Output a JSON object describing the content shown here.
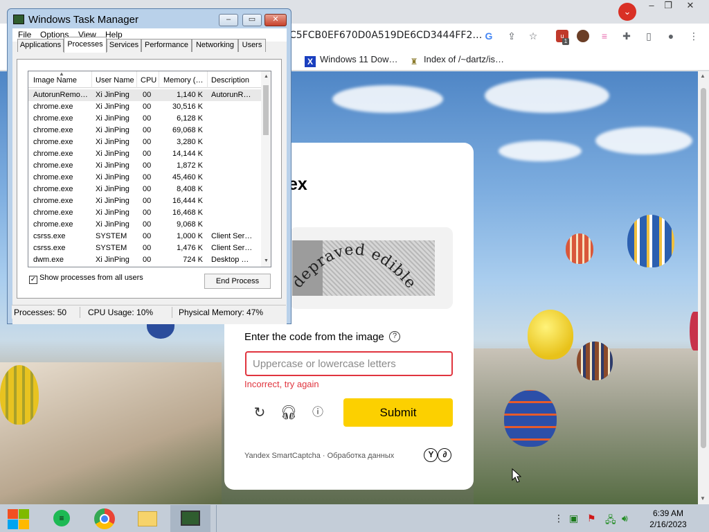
{
  "browser": {
    "url": "C5FCB0EF670D0A519DE6CD3444FF2…",
    "tab_search_icon": "chevron-down-icon",
    "window_controls": [
      "–",
      "❐",
      "✕"
    ],
    "bookmarks": [
      {
        "label": "Windows 11 Dow…",
        "icon": "x-icon"
      },
      {
        "label": "Index of /~dartz/is…",
        "icon": "folder-icon"
      }
    ],
    "extension_badge": "1"
  },
  "task_manager": {
    "title": "Windows Task Manager",
    "menu": [
      "File",
      "Options",
      "View",
      "Help"
    ],
    "tabs": [
      "Applications",
      "Processes",
      "Services",
      "Performance",
      "Networking",
      "Users"
    ],
    "active_tab": "Processes",
    "columns": [
      "Image Name",
      "User Name",
      "CPU",
      "Memory (…",
      "Description"
    ],
    "rows": [
      {
        "name": "AutorunRemo…",
        "user": "Xi JinPing",
        "cpu": "00",
        "mem": "1,140 K",
        "desc": "AutorunR…"
      },
      {
        "name": "chrome.exe",
        "user": "Xi JinPing",
        "cpu": "00",
        "mem": "30,516 K",
        "desc": ""
      },
      {
        "name": "chrome.exe",
        "user": "Xi JinPing",
        "cpu": "00",
        "mem": "6,128 K",
        "desc": ""
      },
      {
        "name": "chrome.exe",
        "user": "Xi JinPing",
        "cpu": "00",
        "mem": "69,068 K",
        "desc": ""
      },
      {
        "name": "chrome.exe",
        "user": "Xi JinPing",
        "cpu": "00",
        "mem": "3,280 K",
        "desc": ""
      },
      {
        "name": "chrome.exe",
        "user": "Xi JinPing",
        "cpu": "00",
        "mem": "14,144 K",
        "desc": ""
      },
      {
        "name": "chrome.exe",
        "user": "Xi JinPing",
        "cpu": "00",
        "mem": "1,872 K",
        "desc": ""
      },
      {
        "name": "chrome.exe",
        "user": "Xi JinPing",
        "cpu": "00",
        "mem": "45,460 K",
        "desc": ""
      },
      {
        "name": "chrome.exe",
        "user": "Xi JinPing",
        "cpu": "00",
        "mem": "8,408 K",
        "desc": ""
      },
      {
        "name": "chrome.exe",
        "user": "Xi JinPing",
        "cpu": "00",
        "mem": "16,444 K",
        "desc": ""
      },
      {
        "name": "chrome.exe",
        "user": "Xi JinPing",
        "cpu": "00",
        "mem": "16,468 K",
        "desc": ""
      },
      {
        "name": "chrome.exe",
        "user": "Xi JinPing",
        "cpu": "00",
        "mem": "9,068 K",
        "desc": ""
      },
      {
        "name": "csrss.exe",
        "user": "SYSTEM",
        "cpu": "00",
        "mem": "1,000 K",
        "desc": "Client Ser…"
      },
      {
        "name": "csrss.exe",
        "user": "SYSTEM",
        "cpu": "00",
        "mem": "1,476 K",
        "desc": "Client Ser…"
      },
      {
        "name": "dwm.exe",
        "user": "Xi JinPing",
        "cpu": "00",
        "mem": "724 K",
        "desc": "Desktop …"
      }
    ],
    "show_all_label": "Show processes from all users",
    "show_all_checked": true,
    "end_process_label": "End Process",
    "status": {
      "processes": "Processes: 50",
      "cpu": "CPU Usage: 10%",
      "memory": "Physical Memory: 47%"
    }
  },
  "captcha": {
    "brand": "ex",
    "image_text": "depraved edible",
    "prompt": "Enter the code from the image",
    "input_placeholder": "Uppercase or lowercase letters",
    "input_value": "",
    "error": "Incorrect, try again",
    "submit_label": "Submit",
    "footer": "Yandex SmartCaptcha · Обработка данных",
    "footer_logo_letters": [
      "Y",
      "∂"
    ],
    "accent_color": "#fcd000",
    "error_color": "#e0343e"
  },
  "taskbar": {
    "apps": [
      "start-icon",
      "notes-app-icon",
      "chrome-icon",
      "file-explorer-icon",
      "task-manager-icon"
    ],
    "time": "6:39 AM",
    "date": "2/16/2023"
  }
}
